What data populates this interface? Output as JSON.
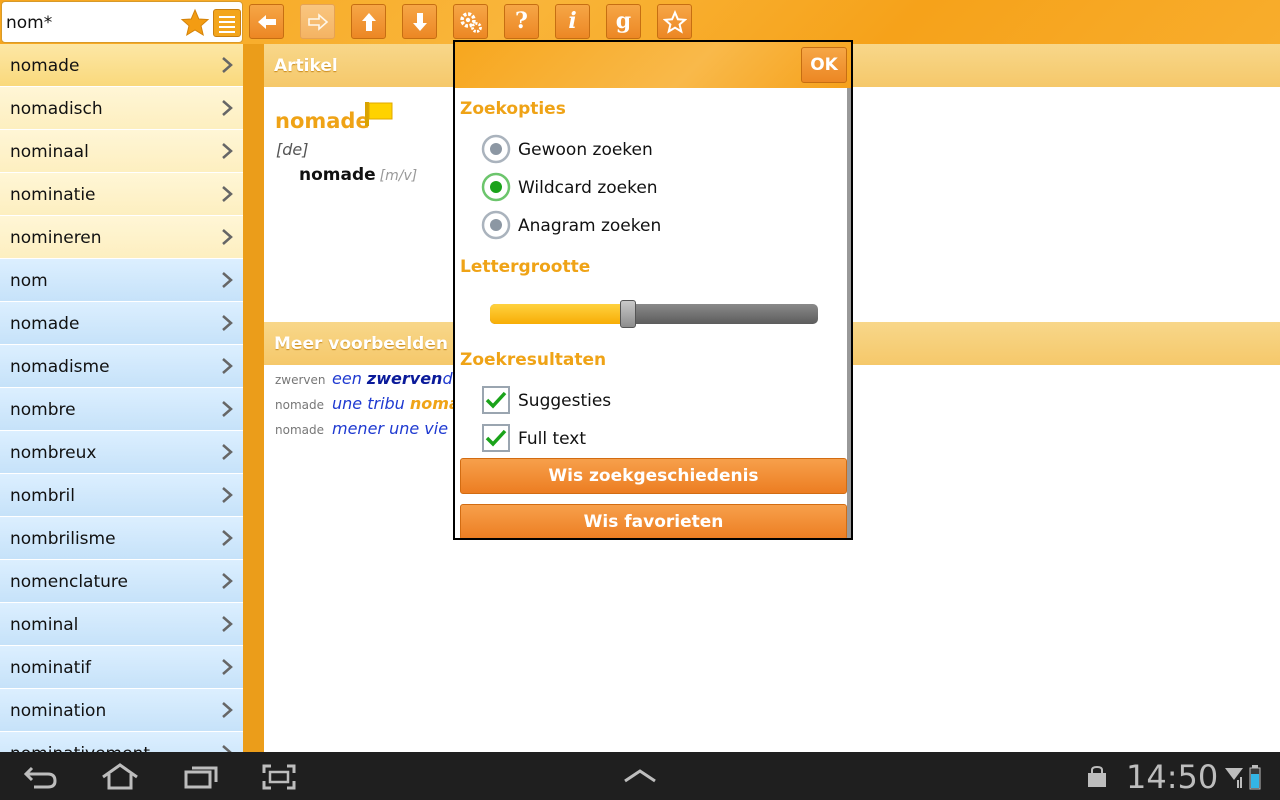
{
  "search": {
    "value": "nom*"
  },
  "toolbar": {
    "buttons": [
      {
        "icon": "arrow-left-icon"
      },
      {
        "icon": "arrow-right-icon"
      },
      {
        "icon": "arrow-up-icon"
      },
      {
        "icon": "arrow-down-icon"
      },
      {
        "icon": "gears-icon"
      },
      {
        "icon": "help-icon",
        "label": "?"
      },
      {
        "icon": "info-icon",
        "label": "i"
      },
      {
        "icon": "g-icon",
        "label": "g"
      },
      {
        "icon": "star-outline-icon"
      }
    ]
  },
  "sidebar": {
    "history": [
      "nomade",
      "nomadisch",
      "nominaal",
      "nominatie",
      "nomineren"
    ],
    "results": [
      "nom",
      "nomade",
      "nomadisme",
      "nombre",
      "nombreux",
      "nombril",
      "nombrilisme",
      "nomenclature",
      "nominal",
      "nominatif",
      "nomination",
      "nominativement"
    ]
  },
  "article": {
    "header": "Artikel",
    "headword": "nomade",
    "grammar": "[de]",
    "translation": "nomade",
    "gender": "[m/v]"
  },
  "examples": {
    "header": "Meer voorbeelden",
    "items": [
      {
        "key": "zwerven",
        "pre": "een ",
        "bold": "zwerven",
        "post": "d b"
      },
      {
        "key": "nomade",
        "pre": "une tribu ",
        "orange": "nomad"
      },
      {
        "key": "nomade",
        "pre": "mener une vie de"
      }
    ]
  },
  "dialog": {
    "ok_label": "OK",
    "search_options_title": "Zoekopties",
    "search_options": [
      {
        "label": "Gewoon zoeken",
        "selected": false
      },
      {
        "label": "Wildcard zoeken",
        "selected": true
      },
      {
        "label": "Anagram zoeken",
        "selected": false
      }
    ],
    "font_size_title": "Lettergrootte",
    "font_size_level": 0.42,
    "results_title": "Zoekresultaten",
    "results_options": [
      {
        "label": "Suggesties",
        "checked": true
      },
      {
        "label": "Full text",
        "checked": true
      }
    ],
    "clear_history_label": "Wis zoekgeschiedenis",
    "clear_favorites_label": "Wis favorieten"
  },
  "statusbar": {
    "time": "14:50"
  },
  "colors": {
    "accent": "#efa316",
    "history_row": "#fdefc0",
    "result_row": "#c6e2f9",
    "link_blue": "#1f3ad1"
  }
}
